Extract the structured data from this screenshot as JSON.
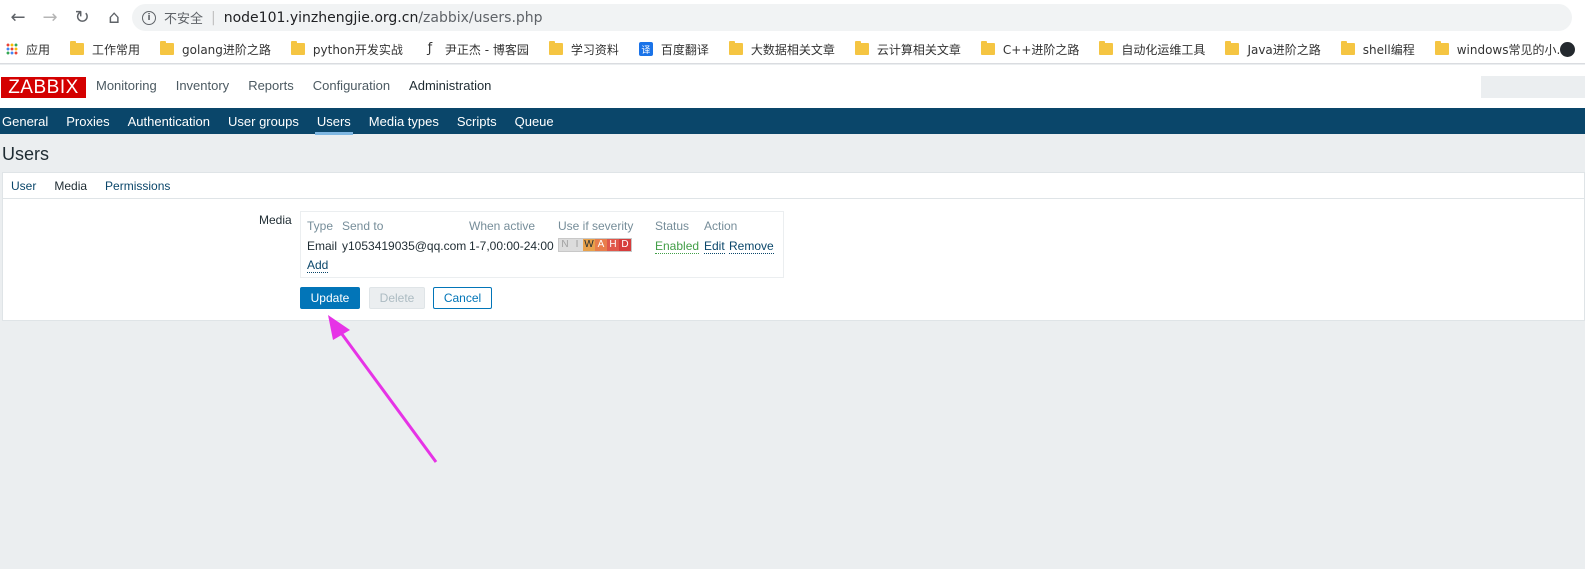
{
  "browser": {
    "insecure_label": "不安全",
    "url_host": "node101.yinzhengjie.org.cn",
    "url_path": "/zabbix/users.php",
    "bookmarks": [
      {
        "label": "应用",
        "icon": "apps-icon"
      },
      {
        "label": "工作常用",
        "icon": "folder-icon"
      },
      {
        "label": "golang进阶之路",
        "icon": "folder-icon"
      },
      {
        "label": "python开发实战",
        "icon": "folder-icon"
      },
      {
        "label": "尹正杰 - 博客园",
        "icon": "cnblogs-icon"
      },
      {
        "label": "学习资料",
        "icon": "folder-icon"
      },
      {
        "label": "百度翻译",
        "icon": "translate-icon"
      },
      {
        "label": "大数据相关文章",
        "icon": "folder-icon"
      },
      {
        "label": "云计算相关文章",
        "icon": "folder-icon"
      },
      {
        "label": "C++进阶之路",
        "icon": "folder-icon"
      },
      {
        "label": "自动化运维工具",
        "icon": "folder-icon"
      },
      {
        "label": "Java进阶之路",
        "icon": "folder-icon"
      },
      {
        "label": "shell编程",
        "icon": "folder-icon"
      },
      {
        "label": "windows常见的小...",
        "icon": "folder-icon"
      }
    ]
  },
  "zabbix": {
    "logo": "ZABBIX",
    "top_menu": [
      "Monitoring",
      "Inventory",
      "Reports",
      "Configuration",
      "Administration"
    ],
    "top_menu_active": "Administration",
    "sub_menu": [
      "General",
      "Proxies",
      "Authentication",
      "User groups",
      "Users",
      "Media types",
      "Scripts",
      "Queue"
    ],
    "sub_menu_active": "Users",
    "page_title": "Users",
    "tabs": [
      "User",
      "Media",
      "Permissions"
    ],
    "tab_active": "Media",
    "form": {
      "media_label": "Media",
      "columns": [
        "Type",
        "Send to",
        "When active",
        "Use if severity",
        "Status",
        "Action"
      ],
      "row": {
        "type": "Email",
        "send_to": "y1053419035@qq.com",
        "when_active": "1-7,00:00-24:00",
        "severity": [
          "N",
          "I",
          "W",
          "A",
          "H",
          "D"
        ],
        "status": "Enabled",
        "edit": "Edit",
        "remove": "Remove"
      },
      "add": "Add",
      "buttons": {
        "update": "Update",
        "delete": "Delete",
        "cancel": "Cancel"
      }
    },
    "colors": {
      "brand": "#d40000",
      "nav": "#0a466a",
      "primary_button": "#0275b8",
      "enabled": "#429e47",
      "annotation_arrow": "#e633e6"
    }
  }
}
